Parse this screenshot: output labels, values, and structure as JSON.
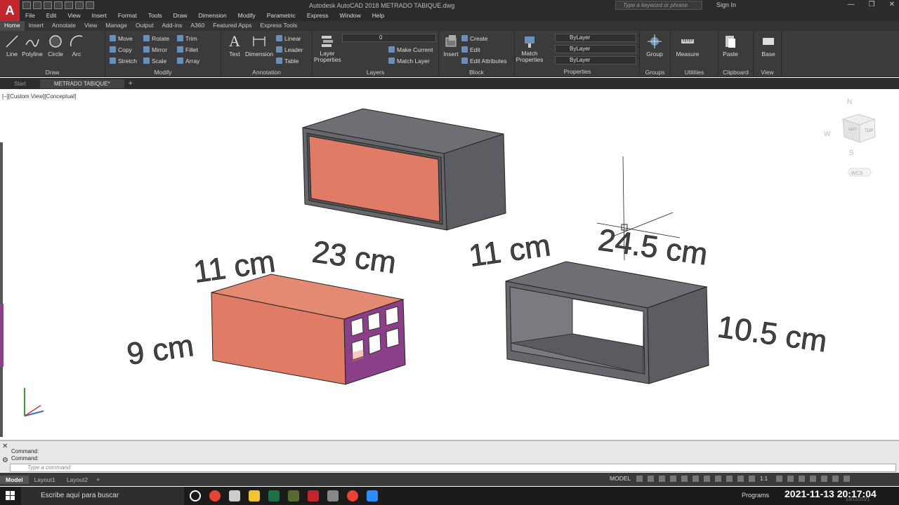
{
  "window": {
    "title": "Autodesk AutoCAD 2018   METRADO TABIQUE.dwg",
    "search_placeholder": "Type a keyword or phrase",
    "signin_label": "Sign In",
    "logo_letter": "A"
  },
  "menu": [
    "File",
    "Edit",
    "View",
    "Insert",
    "Format",
    "Tools",
    "Draw",
    "Dimension",
    "Modify",
    "Parametric",
    "Express",
    "Window",
    "Help"
  ],
  "ribbon_tabs": [
    "Home",
    "Insert",
    "Annotate",
    "View",
    "Manage",
    "Output",
    "Add-ins",
    "A360",
    "Featured Apps",
    "Express Tools"
  ],
  "ribbon": {
    "draw": {
      "title": "Draw",
      "tools": [
        "Line",
        "Polyline",
        "Circle",
        "Arc"
      ]
    },
    "modify": {
      "title": "Modify",
      "tools": [
        "Move",
        "Rotate",
        "Trim",
        "Copy",
        "Mirror",
        "Fillet",
        "Stretch",
        "Scale",
        "Array"
      ]
    },
    "annotation": {
      "title": "Annotation",
      "tools": [
        "Text",
        "Dimension",
        "Linear",
        "Leader",
        "Table"
      ]
    },
    "layers": {
      "title": "Layers",
      "big": "Layer Properties",
      "layer_value": "0",
      "tools": [
        "Make Current",
        "Match Layer"
      ]
    },
    "block": {
      "title": "Block",
      "big": "Insert",
      "tools": [
        "Create",
        "Edit",
        "Edit Attributes"
      ]
    },
    "properties": {
      "title": "Properties",
      "big": "Match Properties",
      "rows": [
        "ByLayer",
        "ByLayer",
        "ByLayer"
      ]
    },
    "groups": {
      "title": "Groups",
      "big": "Group"
    },
    "utilities": {
      "title": "Utilities",
      "big": "Measure"
    },
    "clipboard": {
      "title": "Clipboard",
      "big": "Paste"
    },
    "view": {
      "title": "View",
      "big": "Base"
    }
  },
  "doc_tabs": [
    "Start",
    "METRADO TABIQUE*"
  ],
  "viewport": {
    "label": "[–][Custom View][Conceptual]",
    "viewcube": {
      "north": "N",
      "west": "W",
      "south": "S",
      "top": "TOP",
      "left": "LEFT",
      "wcs": "WCS"
    },
    "dimensions": [
      "11 cm",
      "23 cm",
      "9 cm",
      "11 cm",
      "24.5 cm",
      "10.5 cm"
    ],
    "colors": {
      "brick": "#e07b65",
      "frame": "#6e6e75",
      "frame_dark": "#55555c",
      "hole": "#8a3f88"
    }
  },
  "command": {
    "history": [
      "Command:",
      "Command:"
    ],
    "placeholder": "Type a command"
  },
  "layout_tabs": [
    "Model",
    "Layout1",
    "Layout2"
  ],
  "status": {
    "model": "MODEL",
    "scale": "1:1"
  },
  "taskbar": {
    "search": "Escribe aquí para buscar",
    "programs": "Programs",
    "clock": "2021-11-13  20:17:04",
    "date_small": "13/11/2021"
  }
}
